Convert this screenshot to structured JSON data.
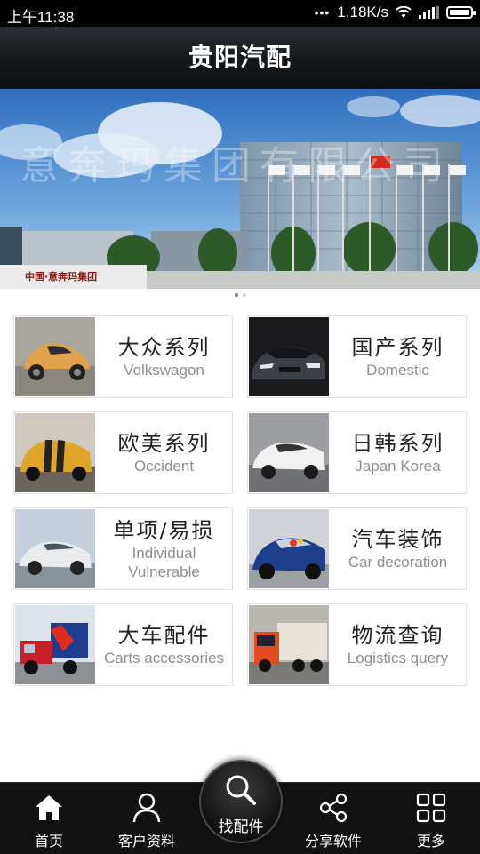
{
  "status_bar": {
    "time": "上午11:38",
    "speed": "1.18K/s"
  },
  "header": {
    "title": "贵阳汽配"
  },
  "banner": {
    "watermark": "意奔玛集团有限公司",
    "sign_text": "中国·意奔玛集团",
    "pages": 2,
    "active_page": 1
  },
  "categories": [
    {
      "cn": "大众系列",
      "en": "Volkswagon"
    },
    {
      "cn": "国产系列",
      "en": "Domestic"
    },
    {
      "cn": "欧美系列",
      "en": "Occident"
    },
    {
      "cn": "日韩系列",
      "en": "Japan Korea"
    },
    {
      "cn": "单项/易损",
      "en": "Individual Vulnerable"
    },
    {
      "cn": "汽车装饰",
      "en": "Car decoration"
    },
    {
      "cn": "大车配件",
      "en": "Carts accessories"
    },
    {
      "cn": "物流查询",
      "en": "Logistics query"
    }
  ],
  "tabbar": {
    "home": "首页",
    "customer": "客户资料",
    "find_parts": "找配件",
    "share": "分享软件",
    "more": "更多"
  }
}
